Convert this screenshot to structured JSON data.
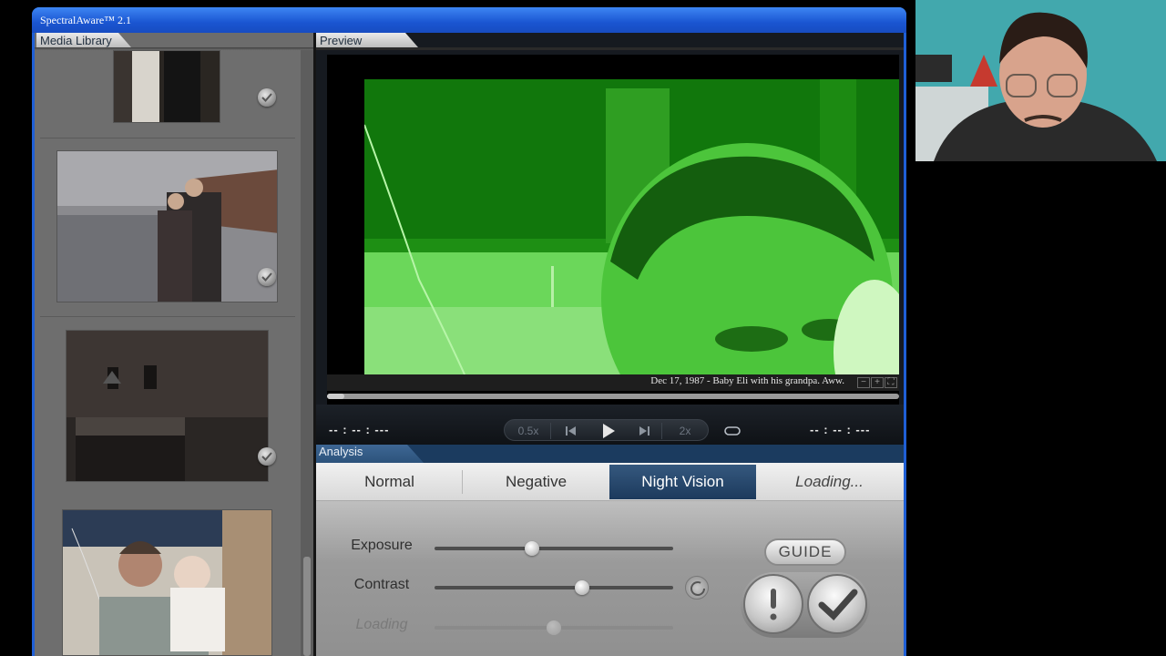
{
  "app": {
    "title": "SpectralAware™ 2.1"
  },
  "library": {
    "tab_label": "Media Library",
    "items": [
      {
        "name": "photo-1",
        "checked": true
      },
      {
        "name": "photo-2",
        "checked": true
      },
      {
        "name": "photo-3",
        "checked": true
      },
      {
        "name": "photo-4",
        "checked": false
      }
    ]
  },
  "preview": {
    "tab_label": "Preview",
    "caption": "Dec 17, 1987 - Baby Eli with his grandpa. Aww.",
    "zoom_out": "−",
    "zoom_in": "+",
    "fullscreen": "⛶",
    "progress": 0.03
  },
  "transport": {
    "time_left": "-- : -- : ---",
    "time_right": "-- : -- : ---",
    "speed_slow": "0.5x",
    "speed_fast": "2x",
    "prev_icon": "step-back-icon",
    "play_icon": "play-icon",
    "next_icon": "step-forward-icon",
    "loop_icon": "loop-icon"
  },
  "analysis": {
    "tab_label": "Analysis",
    "modes": [
      "Normal",
      "Negative",
      "Night Vision",
      "Loading..."
    ],
    "active_mode": "Night Vision",
    "sliders": [
      {
        "label": "Exposure",
        "value": 0.41,
        "enabled": true
      },
      {
        "label": "Contrast",
        "value": 0.62,
        "enabled": true
      },
      {
        "label": "Loading",
        "value": 0.5,
        "enabled": false
      }
    ],
    "guide_label": "GUIDE",
    "alert_icon": "exclamation-icon",
    "confirm_icon": "checkmark-icon",
    "reset_icon": "refresh-icon"
  },
  "colors": {
    "titlebar": "#1a55d1",
    "active_tab": "#1c3a5d",
    "night_vision": "#1a8e16"
  }
}
